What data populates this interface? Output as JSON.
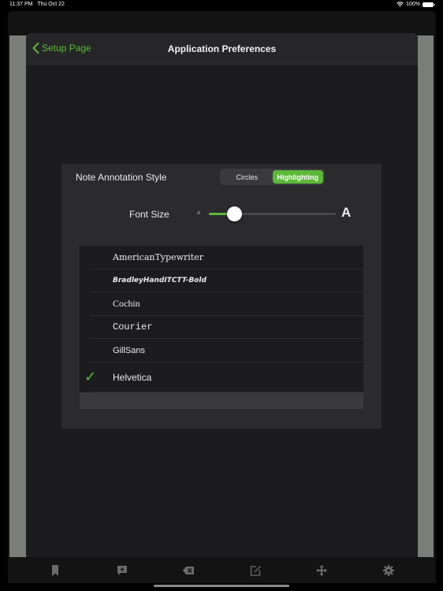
{
  "status_bar": {
    "time": "11:37 PM",
    "date": "Thu Oct 22",
    "battery": "100%"
  },
  "navbar": {
    "back_label": "Setup Page",
    "title": "Application Preferences"
  },
  "preferences": {
    "annotation_style": {
      "label": "Note Annotation Style",
      "options": [
        "Circles",
        "Highlighting"
      ],
      "selected": "Highlighting"
    },
    "font_size": {
      "label": "Font Size",
      "min_glyph": "A",
      "max_glyph": "A",
      "value_fraction": 0.2
    },
    "fonts": {
      "items": [
        {
          "name": "AmericanTypewriter",
          "selected": false
        },
        {
          "name": "BradleyHandITCTT-Bold",
          "selected": false
        },
        {
          "name": "Cochin",
          "selected": false
        },
        {
          "name": "Courier",
          "selected": false
        },
        {
          "name": "GillSans",
          "selected": false
        },
        {
          "name": "Helvetica",
          "selected": true
        }
      ],
      "check_glyph": "✓"
    }
  },
  "toolbar": {
    "items": [
      {
        "icon": "bookmark-icon"
      },
      {
        "icon": "add-comment-icon"
      },
      {
        "icon": "delete-icon"
      },
      {
        "icon": "edit-icon"
      },
      {
        "icon": "move-icon"
      },
      {
        "icon": "settings-icon"
      }
    ]
  },
  "colors": {
    "accent": "#5cb83a",
    "background": "#1c1c1e",
    "panel": "#2b2b2d"
  }
}
